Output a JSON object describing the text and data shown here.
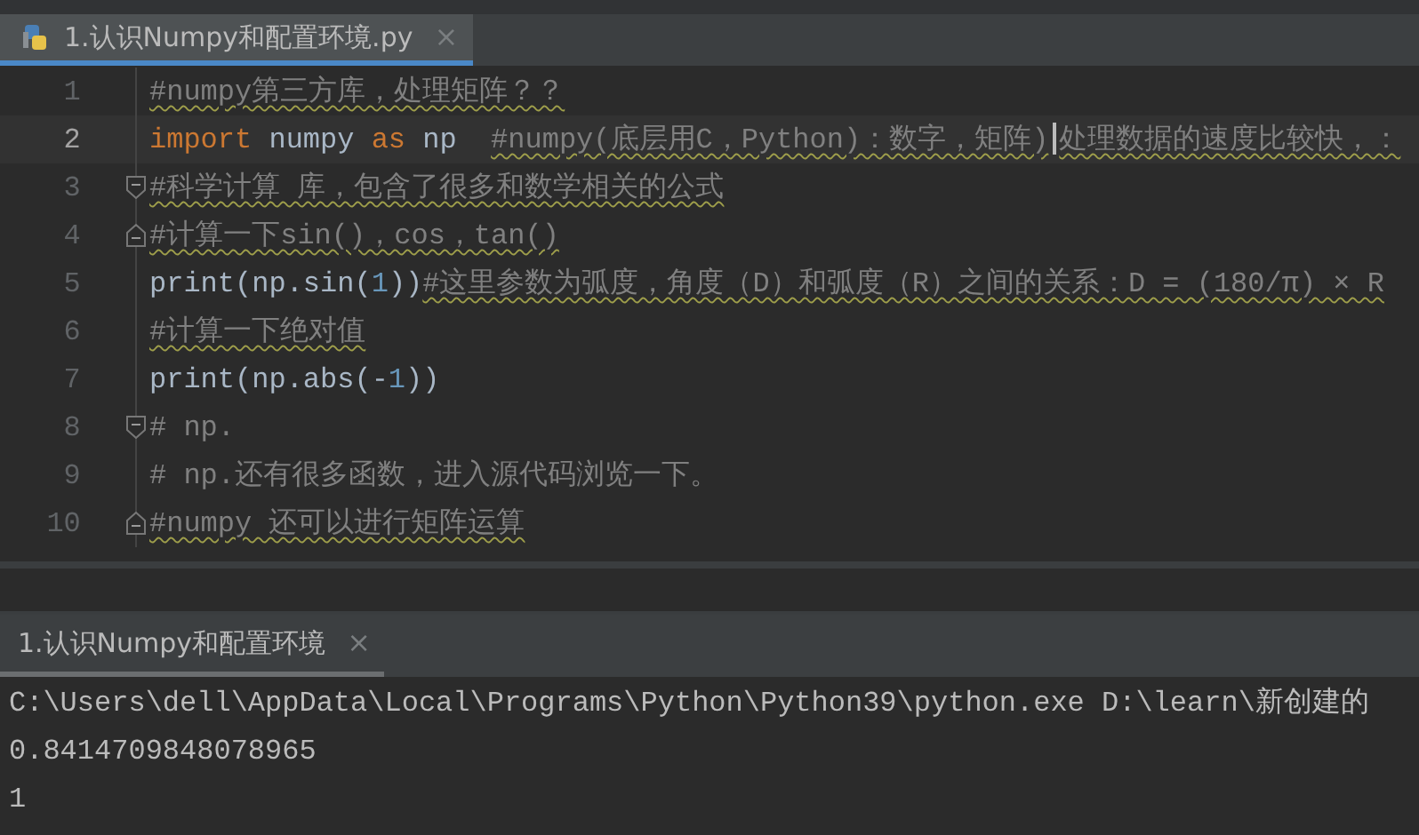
{
  "editor_tabs": [
    {
      "label": "1.认识Numpy和配置环境.py",
      "close": "×",
      "selected": true
    }
  ],
  "code_lines": [
    {
      "number": "1",
      "current": false,
      "fold_start": false,
      "fold_end": false,
      "tokens": [
        {
          "text": "#numpy第三方库，处理矩阵？？",
          "kind": "comment",
          "typo": true
        }
      ]
    },
    {
      "number": "2",
      "current": true,
      "fold_start": false,
      "fold_end": false,
      "tokens": [
        {
          "text": "import",
          "kind": "keyword",
          "typo": false
        },
        {
          "text": " numpy ",
          "kind": "ident",
          "typo": false
        },
        {
          "text": "as",
          "kind": "keyword",
          "typo": false
        },
        {
          "text": " np  ",
          "kind": "ident",
          "typo": false
        },
        {
          "text": "#numpy(底层用C，Python)：数字，矩阵)",
          "kind": "comment",
          "typo": true,
          "caret": true
        },
        {
          "text": "处理数据的速度比较快，：",
          "kind": "comment",
          "typo": true
        }
      ]
    },
    {
      "number": "3",
      "current": false,
      "fold_start": true,
      "fold_end": false,
      "tokens": [
        {
          "text": "#科学计算 库，包含了很多和数学相关的公式",
          "kind": "comment",
          "typo": true
        }
      ]
    },
    {
      "number": "4",
      "current": false,
      "fold_start": false,
      "fold_end": true,
      "tokens": [
        {
          "text": "#计算一下sin()，cos，tan()",
          "kind": "comment",
          "typo": true
        }
      ]
    },
    {
      "number": "5",
      "current": false,
      "fold_start": false,
      "fold_end": false,
      "tokens": [
        {
          "text": "print(np.sin(",
          "kind": "ident",
          "typo": false
        },
        {
          "text": "1",
          "kind": "number",
          "typo": false
        },
        {
          "text": "))",
          "kind": "ident",
          "typo": false
        },
        {
          "text": "#这里参数为弧度，角度（D）和弧度（R）之间的关系：D = (180/π) × R",
          "kind": "comment",
          "typo": true
        }
      ]
    },
    {
      "number": "6",
      "current": false,
      "fold_start": false,
      "fold_end": false,
      "tokens": [
        {
          "text": "#计算一下绝对值",
          "kind": "comment",
          "typo": true
        }
      ]
    },
    {
      "number": "7",
      "current": false,
      "fold_start": false,
      "fold_end": false,
      "tokens": [
        {
          "text": "print(np.abs(-",
          "kind": "ident",
          "typo": false
        },
        {
          "text": "1",
          "kind": "number",
          "typo": false
        },
        {
          "text": "))",
          "kind": "ident",
          "typo": false
        }
      ]
    },
    {
      "number": "8",
      "current": false,
      "fold_start": true,
      "fold_end": false,
      "tokens": [
        {
          "text": "# np.",
          "kind": "comment",
          "typo": false
        }
      ]
    },
    {
      "number": "9",
      "current": false,
      "fold_start": false,
      "fold_end": false,
      "tokens": [
        {
          "text": "# np.还有很多函数，进入源代码浏览一下。",
          "kind": "comment",
          "typo": false
        }
      ]
    },
    {
      "number": "10",
      "current": false,
      "fold_start": false,
      "fold_end": true,
      "tokens": [
        {
          "text": "#numpy 还可以进行矩阵运算",
          "kind": "comment",
          "typo": true
        }
      ]
    }
  ],
  "run_tabs": [
    {
      "label": "1.认识Numpy和配置环境",
      "close": "×",
      "selected": true
    }
  ],
  "console_lines": [
    "C:\\Users\\dell\\AppData\\Local\\Programs\\Python\\Python39\\python.exe D:\\learn\\新创建的",
    "0.8414709848078965",
    "1"
  ]
}
